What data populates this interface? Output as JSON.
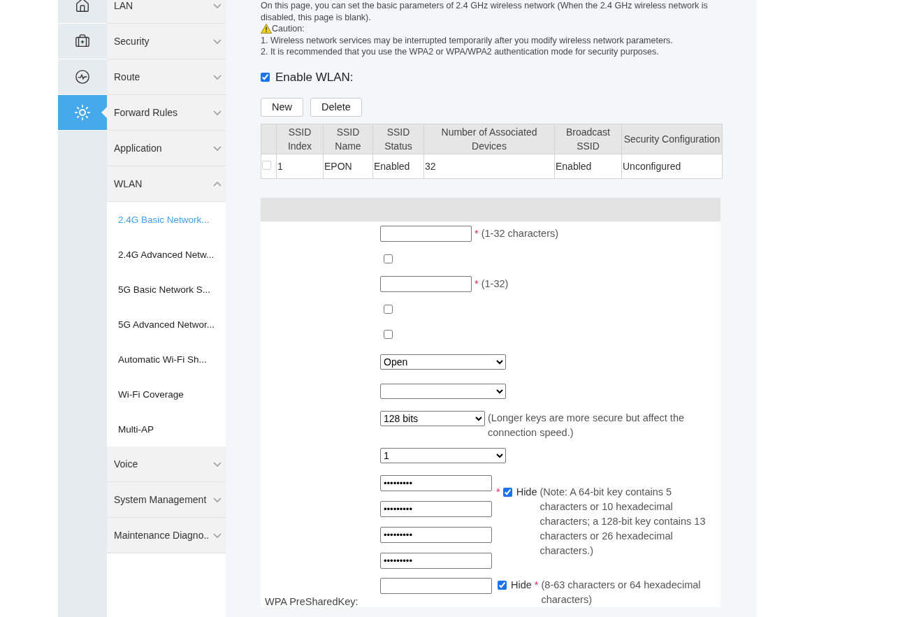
{
  "rail": [
    {
      "selected": false
    },
    {
      "selected": false
    },
    {
      "selected": false
    },
    {
      "selected": true
    }
  ],
  "menu": [
    {
      "label": "LAN",
      "expanded": false
    },
    {
      "label": "Security",
      "expanded": false
    },
    {
      "label": "Route",
      "expanded": false
    },
    {
      "label": "Forward Rules",
      "expanded": false
    },
    {
      "label": "Application",
      "expanded": false
    },
    {
      "label": "WLAN",
      "expanded": true,
      "children": [
        {
          "label": "2.4G Basic Network...",
          "selected": true
        },
        {
          "label": "2.4G Advanced Netw...",
          "selected": false
        },
        {
          "label": "5G Basic Network S...",
          "selected": false
        },
        {
          "label": "5G Advanced Networ...",
          "selected": false
        },
        {
          "label": "Automatic Wi-Fi Sh...",
          "selected": false
        },
        {
          "label": "Wi-Fi Coverage",
          "selected": false
        },
        {
          "label": "Multi-AP",
          "selected": false
        }
      ]
    },
    {
      "label": "Voice",
      "expanded": false
    },
    {
      "label": "System Management",
      "expanded": false
    },
    {
      "label": "Maintenance Diagno..",
      "expanded": false
    }
  ],
  "intro": {
    "description": "On this page, you can set the basic parameters of 2.4 GHz wireless network (When the 2.4 GHz wireless network is disabled, this page is blank).",
    "caution": "Caution:",
    "notes": [
      "1. Wireless network services may be interrupted temporarily after you modify wireless network parameters.",
      "2. It is recommended that you use the WPA2 or WPA/WPA2 authentication mode for security purposes."
    ]
  },
  "enable_wlan": {
    "label": "Enable WLAN:",
    "checked": true
  },
  "buttons": [
    "New",
    "Delete"
  ],
  "table": {
    "columns": [
      "SSID Index",
      "SSID Name",
      "SSID Status",
      "Number of Associated Devices",
      "Broadcast SSID",
      "Security Configuration"
    ],
    "rows": [
      {
        "checked": false,
        "cells": [
          "1",
          "EPON",
          "Enabled",
          "32",
          "Enabled",
          "Unconfigured"
        ]
      }
    ]
  },
  "form": {
    "rows": [
      {
        "kind": "input",
        "mark": "*",
        "hint": "(1-32 characters)"
      },
      {
        "kind": "checkbox",
        "checked": false
      },
      {
        "kind": "input",
        "mark": "*",
        "hint": "(1-32)"
      },
      {
        "kind": "checkbox",
        "checked": false
      },
      {
        "kind": "checkbox",
        "checked": false
      },
      {
        "kind": "select",
        "value": "Open"
      },
      {
        "kind": "select"
      },
      {
        "kind": "select",
        "value": "128 bits",
        "hint": "(Longer keys are more secure but affect the connection speed.)"
      },
      {
        "kind": "select",
        "value": "1"
      },
      {
        "kind": "keys",
        "keys": [
          "•••••••••",
          "•••••••••",
          "•••••••••",
          "•••••••••"
        ],
        "mark": "*",
        "hide_label": "Hide",
        "hide_checked": true,
        "hint": "(Note: A 64-bit key contains 5 characters or 10 hexadecimal characters; a 128-bit key contains 13 characters or 26 hexadecimal characters.)"
      },
      {
        "kind": "password",
        "label": "WPA PreSharedKey:",
        "hide_label": "Hide",
        "hide_checked": true,
        "mark": "*",
        "hint": "(8-63 characters or 64 hexadecimal characters)"
      }
    ]
  }
}
